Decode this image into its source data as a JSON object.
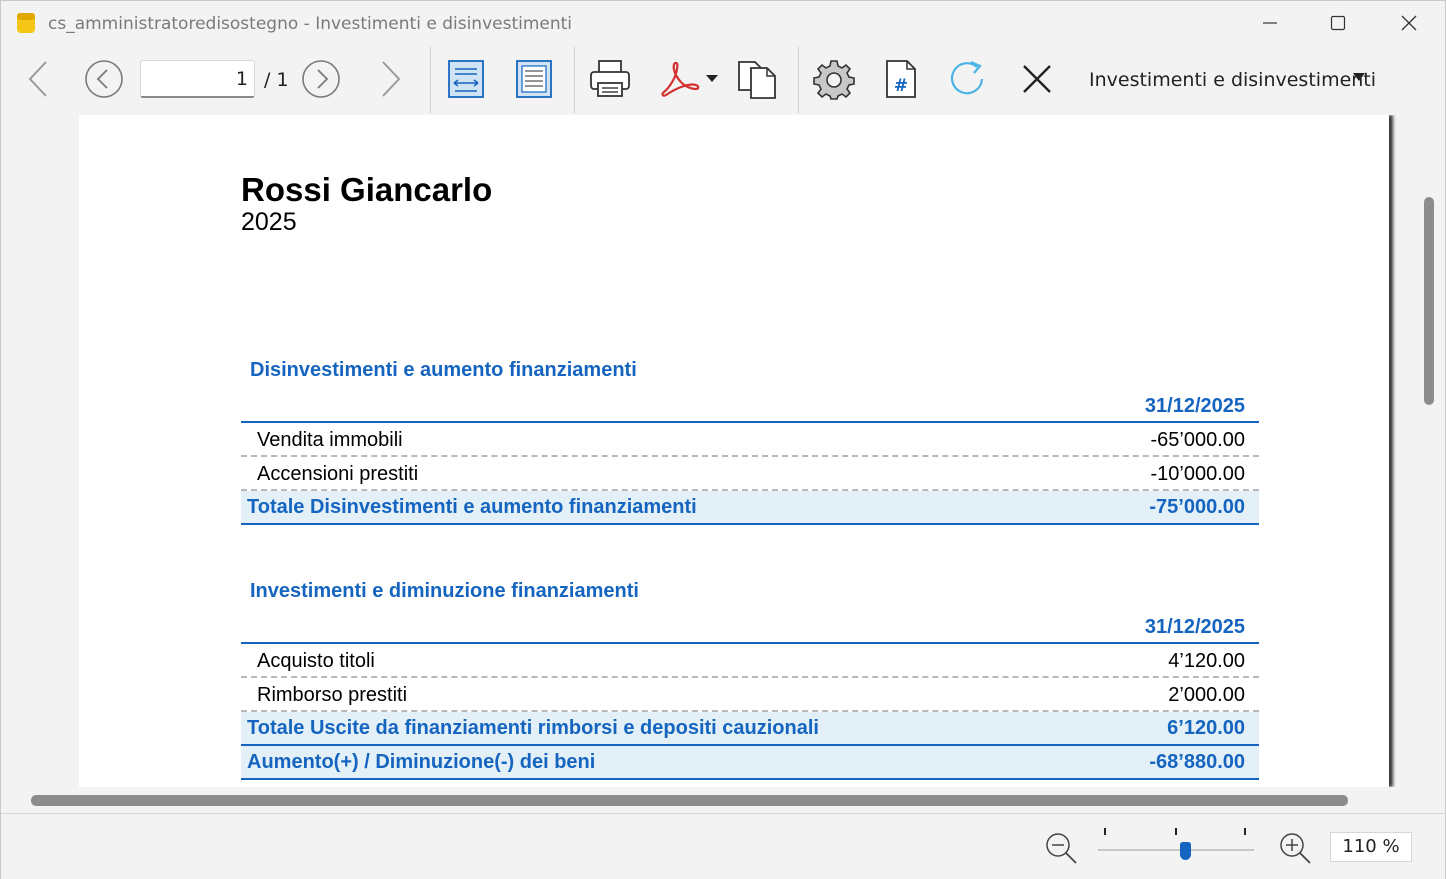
{
  "window": {
    "title": "cs_amministratoredisostegno - Investimenti e disinvestimenti"
  },
  "toolbar": {
    "page_number": "1",
    "page_total": "/ 1",
    "report_selected": "Investimenti e disinvestimenti"
  },
  "report": {
    "name": "Rossi Giancarlo",
    "year": "2025",
    "sections": [
      {
        "title": "Disinvestimenti e aumento finanziamenti",
        "column_header": "31/12/2025",
        "rows": [
          {
            "label": "Vendita immobili",
            "value": "-65’000.00"
          },
          {
            "label": "Accensioni prestiti",
            "value": "-10’000.00"
          }
        ],
        "total": {
          "label": "Totale Disinvestimenti e aumento finanziamenti",
          "value": "-75’000.00"
        }
      },
      {
        "title": "Investimenti e diminuzione finanziamenti",
        "column_header": "31/12/2025",
        "rows": [
          {
            "label": "Acquisto titoli",
            "value": "4’120.00"
          },
          {
            "label": "Rimborso prestiti",
            "value": "2’000.00"
          }
        ],
        "total": {
          "label": "Totale Uscite da finanziamenti rimborsi e depositi cauzionali",
          "value": "6’120.00"
        }
      }
    ],
    "grand_total": {
      "label": "Aumento(+) / Diminuzione(-) dei beni",
      "value": "-68’880.00"
    }
  },
  "statusbar": {
    "zoom": "110 %"
  },
  "colors": {
    "accent": "#1565c0",
    "total_row_bg": "#e3f0f7",
    "pdf_red": "#d32f2f",
    "app_icon": "#f5c518"
  }
}
